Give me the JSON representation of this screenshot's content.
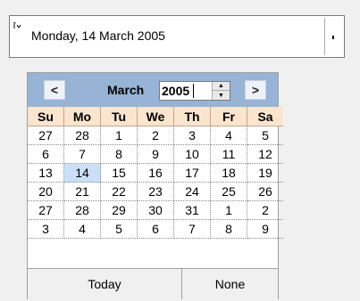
{
  "combo": {
    "value": "Monday, 14 March 2005",
    "dropdown_icon": "chevron-down-icon"
  },
  "calendar": {
    "month": "March",
    "year": "2005",
    "prev_label": "<",
    "next_label": ">",
    "day_headers": [
      "Su",
      "Mo",
      "Tu",
      "We",
      "Th",
      "Fr",
      "Sa"
    ],
    "weeks": [
      [
        "27",
        "28",
        "1",
        "2",
        "3",
        "4",
        "5"
      ],
      [
        "6",
        "7",
        "8",
        "9",
        "10",
        "11",
        "12"
      ],
      [
        "13",
        "14",
        "15",
        "16",
        "17",
        "18",
        "19"
      ],
      [
        "20",
        "21",
        "22",
        "23",
        "24",
        "25",
        "26"
      ],
      [
        "27",
        "28",
        "29",
        "30",
        "31",
        "1",
        "2"
      ],
      [
        "3",
        "4",
        "5",
        "6",
        "7",
        "8",
        "9"
      ]
    ],
    "selected_day": "14",
    "today_label": "Today",
    "none_label": "None"
  },
  "colors": {
    "header_bg": "#97b4d6",
    "dayheader_bg": "#fbe5cf",
    "selected_bg": "#cbe0f8"
  }
}
